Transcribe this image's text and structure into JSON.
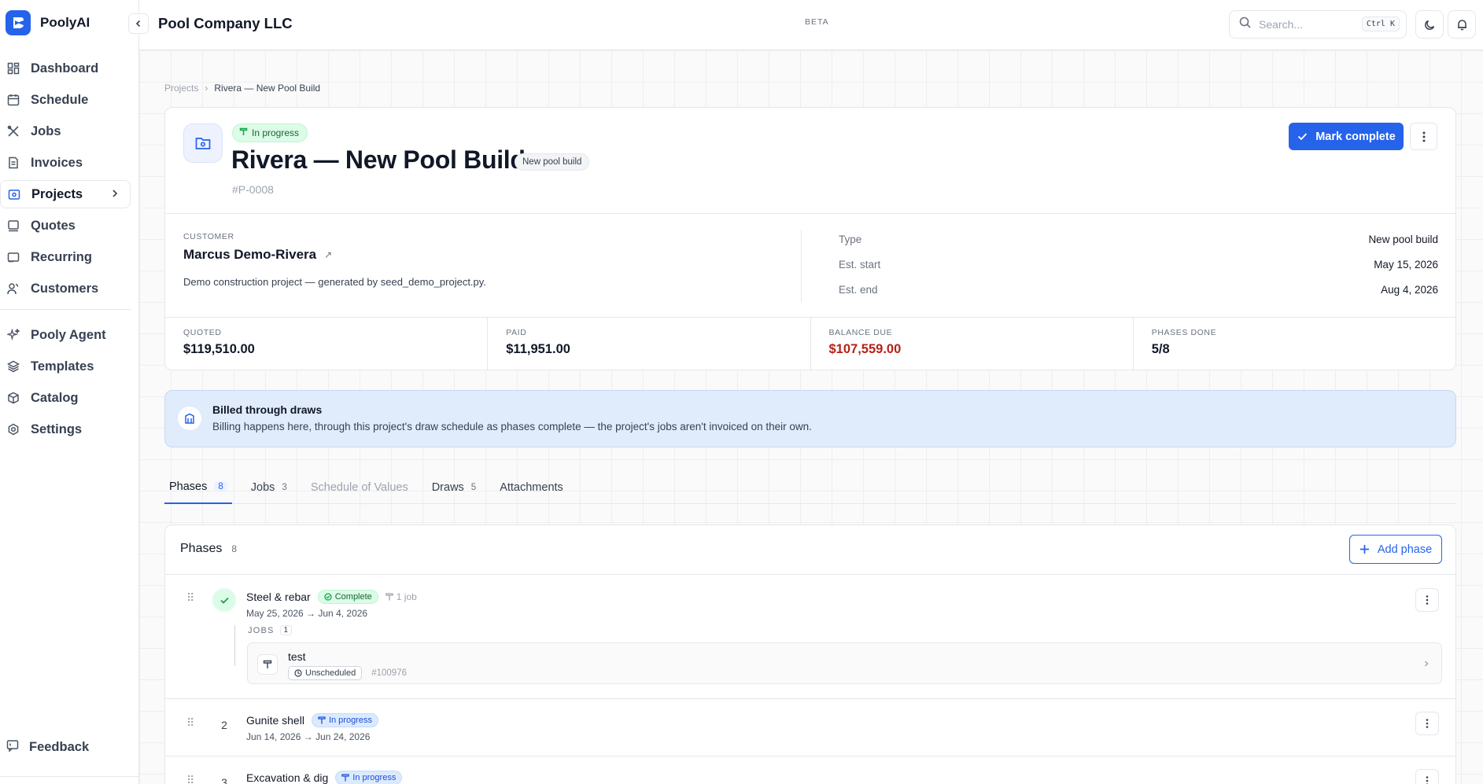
{
  "brand": {
    "name": "PoolyAI"
  },
  "nav": {
    "primary": [
      {
        "label": "Dashboard",
        "icon": "dashboard-icon"
      },
      {
        "label": "Schedule",
        "icon": "calendar-icon"
      },
      {
        "label": "Jobs",
        "icon": "tools-icon"
      },
      {
        "label": "Invoices",
        "icon": "invoice-icon"
      },
      {
        "label": "Projects",
        "icon": "folder-icon",
        "active": true
      },
      {
        "label": "Quotes",
        "icon": "quote-icon"
      },
      {
        "label": "Recurring",
        "icon": "recurring-icon"
      },
      {
        "label": "Customers",
        "icon": "users-icon"
      }
    ],
    "secondary": [
      {
        "label": "Pooly Agent",
        "icon": "sparkle-icon"
      },
      {
        "label": "Templates",
        "icon": "layers-icon"
      },
      {
        "label": "Catalog",
        "icon": "box-icon"
      },
      {
        "label": "Settings",
        "icon": "gear-icon"
      }
    ],
    "feedback": "Feedback"
  },
  "topbar": {
    "company": "Pool Company LLC",
    "beta": "BETA",
    "search_placeholder": "Search...",
    "shortcut": "Ctrl K"
  },
  "breadcrumb": {
    "parent": "Projects",
    "current": "Rivera — New Pool Build"
  },
  "project": {
    "status": "In progress",
    "title": "Rivera — New Pool Build",
    "type_chip": "New pool build",
    "number": "#P-0008",
    "mark_complete": "Mark complete",
    "customer_label": "CUSTOMER",
    "customer_name": "Marcus Demo-Rivera",
    "description": "Demo construction project — generated by seed_demo_project.py.",
    "meta": [
      {
        "key": "Type",
        "value": "New pool build"
      },
      {
        "key": "Est. start",
        "value": "May 15, 2026"
      },
      {
        "key": "Est. end",
        "value": "Aug 4, 2026"
      }
    ],
    "stats": [
      {
        "label": "QUOTED",
        "value": "$119,510.00"
      },
      {
        "label": "PAID",
        "value": "$11,951.00"
      },
      {
        "label": "BALANCE DUE",
        "value": "$107,559.00"
      },
      {
        "label": "PHASES DONE",
        "value": "5/8"
      }
    ]
  },
  "banner": {
    "title": "Billed through draws",
    "text": "Billing happens here, through this project's draw schedule as phases complete — the project's jobs aren't invoiced on their own."
  },
  "tabs": [
    {
      "label": "Phases",
      "count": "8"
    },
    {
      "label": "Jobs",
      "count": "3"
    },
    {
      "label": "Schedule of Values",
      "count": ""
    },
    {
      "label": "Draws",
      "count": "5"
    },
    {
      "label": "Attachments",
      "count": ""
    }
  ],
  "phases": {
    "title": "Phases",
    "count": "8",
    "add_label": "Add phase",
    "rows": [
      {
        "num": "✓",
        "name": "Steel & rebar",
        "status": "Complete",
        "job_count": "1 job",
        "dates": "May 25, 2026 → Jun 4, 2026",
        "jobs_label": "JOBS",
        "jobs_count": "1",
        "job": {
          "name": "test",
          "status": "Unscheduled",
          "number": "#100976"
        }
      },
      {
        "num": "2",
        "name": "Gunite shell",
        "status": "In progress",
        "dates": "Jun 14, 2026 → Jun 24, 2026"
      },
      {
        "num": "3",
        "name": "Excavation & dig",
        "status": "In progress",
        "dates": ""
      }
    ]
  },
  "colors": {
    "accent": "#2563eb",
    "success": "#16a34a",
    "danger": "#b42318"
  }
}
